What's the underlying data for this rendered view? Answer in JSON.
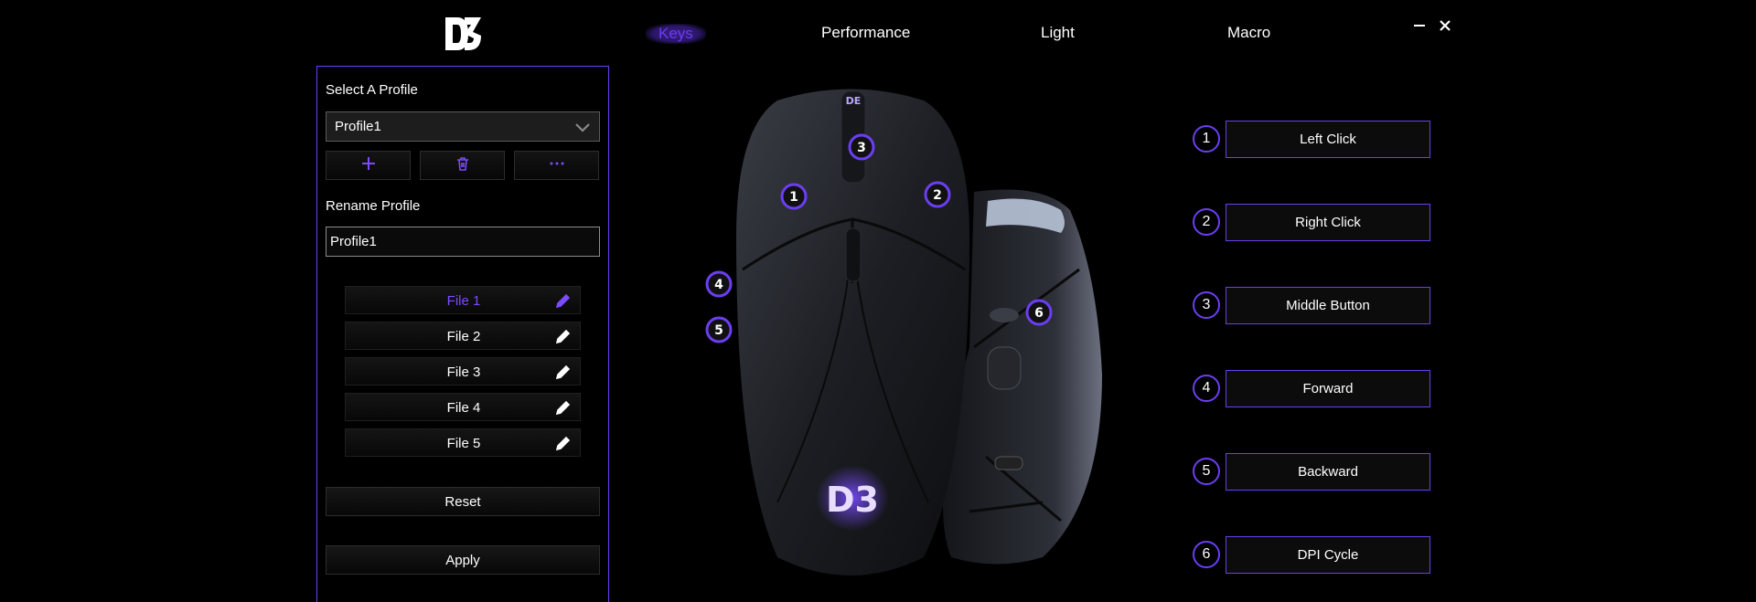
{
  "app": {
    "logo_text": "D3",
    "tabs": [
      {
        "label": "Keys"
      },
      {
        "label": "Performance"
      },
      {
        "label": "Light"
      },
      {
        "label": "Macro"
      }
    ],
    "active_tab": "Keys"
  },
  "profile_panel": {
    "select_label": "Select A Profile",
    "selected_profile": "Profile1",
    "rename_label": "Rename Profile",
    "rename_value": "Profile1",
    "files": [
      {
        "label": "File 1",
        "active": true
      },
      {
        "label": "File 2",
        "active": false
      },
      {
        "label": "File 3",
        "active": false
      },
      {
        "label": "File 4",
        "active": false
      },
      {
        "label": "File 5",
        "active": false
      }
    ],
    "reset_label": "Reset",
    "apply_label": "Apply"
  },
  "mouse": {
    "markers": [
      "1",
      "2",
      "3",
      "4",
      "5",
      "6"
    ]
  },
  "assignments": [
    {
      "num": "1",
      "label": "Left Click"
    },
    {
      "num": "2",
      "label": "Right Click"
    },
    {
      "num": "3",
      "label": "Middle Button"
    },
    {
      "num": "4",
      "label": "Forward"
    },
    {
      "num": "5",
      "label": "Backward"
    },
    {
      "num": "6",
      "label": "DPI Cycle"
    }
  ],
  "colors": {
    "accent": "#6b3ef2",
    "accent_text": "#7b4bff",
    "background": "#000000"
  }
}
